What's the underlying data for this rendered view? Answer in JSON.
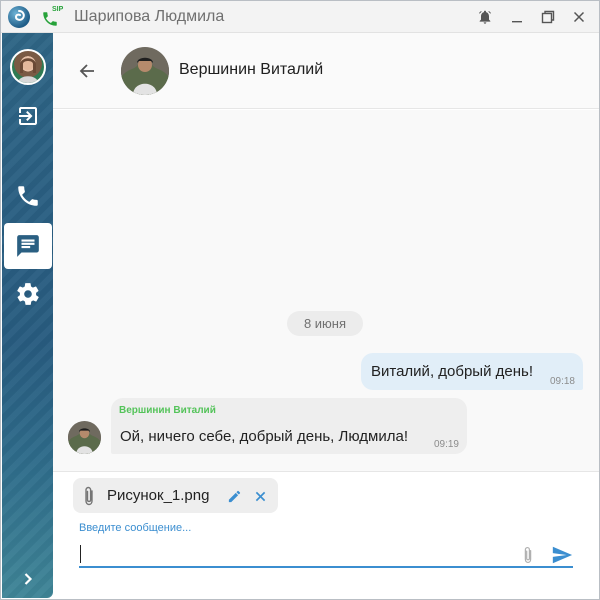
{
  "window": {
    "title": "Шарипова Людмила",
    "sip_label": "SIP",
    "controls": {
      "minimize": "_",
      "maximize": "☐",
      "close": "✕"
    }
  },
  "sidebar": {
    "items": [
      {
        "name": "logout",
        "icon": "logout-icon"
      },
      {
        "name": "calls",
        "icon": "phone-icon"
      },
      {
        "name": "chats",
        "icon": "chat-icon",
        "selected": true
      },
      {
        "name": "settings",
        "icon": "gear-icon"
      },
      {
        "name": "expand",
        "icon": "chevron-right-icon"
      }
    ]
  },
  "chat": {
    "contact_name": "Вершинин Виталий",
    "date_divider": "8 июня",
    "messages": [
      {
        "direction": "outgoing",
        "text": "Виталий, добрый день!",
        "time": "09:18"
      },
      {
        "direction": "incoming",
        "sender": "Вершинин Виталий",
        "text": "Ой, ничего себе, добрый день, Людмила!",
        "time": "09:19"
      }
    ]
  },
  "composer": {
    "attachment": {
      "file_name": "Рисунок_1.png"
    },
    "input_label": "Введите сообщение...",
    "input_value": ""
  },
  "colors": {
    "accent": "#3b8ed0",
    "sender_name": "#54c35a",
    "outgoing_bubble": "#e1eef8",
    "incoming_bubble": "#eeeeee",
    "sidebar": "#2a5f82"
  }
}
